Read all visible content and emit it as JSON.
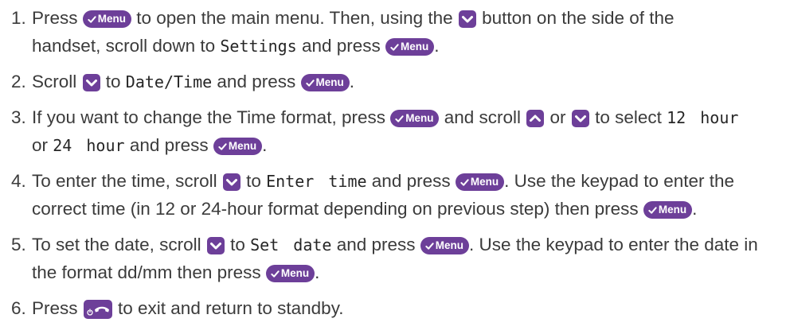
{
  "colors": {
    "text": "#3b3b3b",
    "display_text": "#262626",
    "key": "#6d3f99",
    "key_symbol": "#ffffff",
    "background": "#ffffff"
  },
  "keys": {
    "menu": {
      "label": "Menu",
      "icon": "check-icon"
    },
    "scroll_down": {
      "icon": "chevron-down-icon"
    },
    "scroll_up": {
      "icon": "chevron-up-icon"
    },
    "end": {
      "icon": "end-call-icon"
    }
  },
  "steps": [
    {
      "number": "1.",
      "text": [
        "Press ",
        " to open the main menu. Then, using the ",
        " button on the side of the",
        "handset, scroll down to ",
        " and press ",
        "."
      ],
      "display": [
        "Settings"
      ]
    },
    {
      "number": "2.",
      "text": [
        "Scroll ",
        " to ",
        " and press ",
        "."
      ],
      "display": [
        "Date/Time"
      ]
    },
    {
      "number": "3.",
      "text": [
        "If you want to change the Time format, press ",
        " and scroll ",
        " or ",
        " to select ",
        "or ",
        " and press ",
        "."
      ],
      "display": [
        "12 hour",
        "24 hour"
      ]
    },
    {
      "number": "4.",
      "text": [
        "To enter the time, scroll ",
        " to ",
        " and press ",
        ". Use the keypad to enter the",
        "correct time (in 12 or 24-hour format depending on previous step) then press ",
        "."
      ],
      "display": [
        "Enter time"
      ]
    },
    {
      "number": "5.",
      "text": [
        "To set the date, scroll ",
        " to ",
        " and press ",
        ". Use the keypad to enter the date in",
        "the format dd/mm then press ",
        "."
      ],
      "display": [
        "Set date"
      ]
    },
    {
      "number": "6.",
      "text": [
        "Press ",
        " to exit and return to standby."
      ],
      "display": []
    }
  ]
}
